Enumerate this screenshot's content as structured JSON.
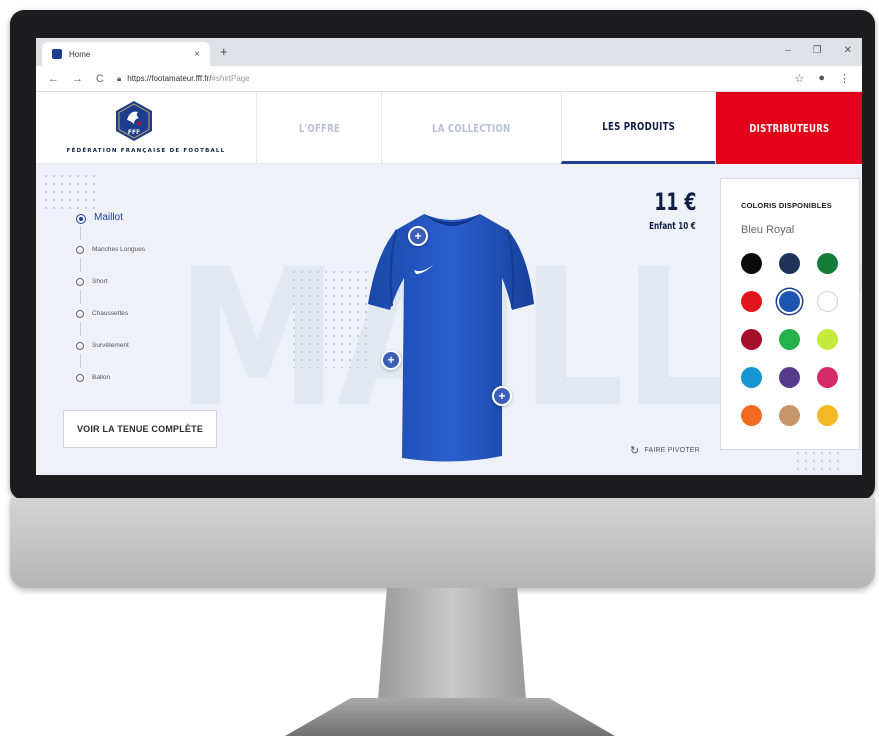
{
  "browser": {
    "tab_title": "Home",
    "tab_close": "×",
    "new_tab": "+",
    "window_controls": [
      "–",
      "❐",
      "✕"
    ],
    "nav_back": "←",
    "nav_forward": "→",
    "nav_reload": "C",
    "url_base": "https://footamateur.fff.fr/",
    "url_hash": "#shirtPage",
    "star_icon": "☆",
    "account_icon": "●",
    "menu_icon": "⋮"
  },
  "brand": {
    "federation_name": "FÉDÉRATION FRANÇAISE DE FOOTBALL",
    "crest_text": "FFF"
  },
  "nav": {
    "offre": "L'OFFRE",
    "collection": "LA COLLECTION",
    "produits": "LES PRODUITS",
    "distributeurs": "DISTRIBUTEURS"
  },
  "product_menu": {
    "items": [
      "Maillot",
      "Manches Longues",
      "Short",
      "Chaussettes",
      "Survêtement",
      "Ballon"
    ],
    "active_index": 0
  },
  "outfit_button": "VOIR LA TENUE COMPLÈTE",
  "background_word": "MAILLOT",
  "price": {
    "main": "11 €",
    "child": "Enfant 10 €"
  },
  "rotate_label": "FAIRE PIVOTER",
  "colors": {
    "title": "COLORIS DISPONIBLES",
    "selected_name": "Bleu Royal",
    "swatches": [
      "#0b0b0b",
      "#1f3257",
      "#167c3a",
      "#e0161a",
      "#1d55b3",
      "#ffffff",
      "#a50f2c",
      "#23b34a",
      "#c5ea3c",
      "#1495cf",
      "#553a8c",
      "#d42a68",
      "#f46a23",
      "#c7956a",
      "#f5b825"
    ],
    "selected_index": 4
  },
  "accent": {
    "navy": "#0e1e45",
    "royal_blue": "#1d3d8f",
    "red": "#e2001a"
  }
}
